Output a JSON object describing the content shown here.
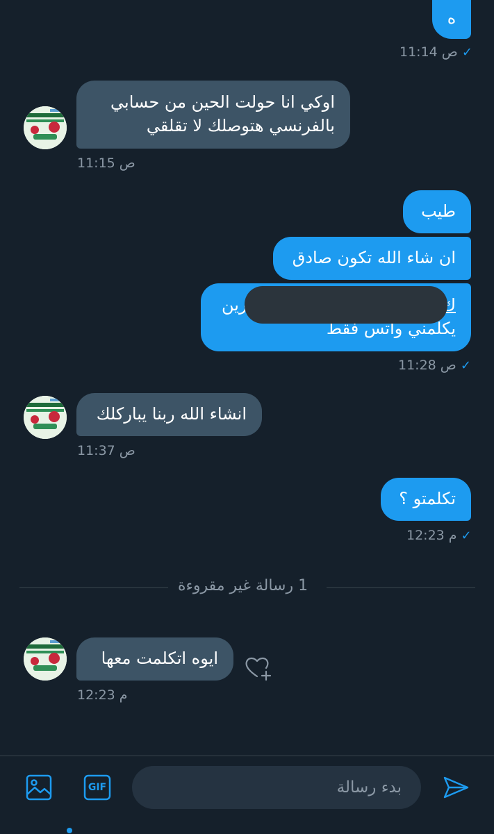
{
  "messages": [
    {
      "text": "ه"
    },
    {
      "time": "11:14 ص"
    },
    {
      "text_line1": "اوكي انا حولت الحين من حسابي",
      "text_line2": "بالفرنسي هتوصلك لا تقلقي"
    },
    {
      "time": "11:15 ص"
    },
    {
      "text": "طيب"
    },
    {
      "text": "ان شاء الله تكون صادق"
    },
    {
      "text_line1_start": "ك",
      "text_line1_end": "برين",
      "text_line2": "يكلمني واتس فقط"
    },
    {
      "time": "11:28 ص"
    },
    {
      "text": "انشاء الله ربنا يباركلك"
    },
    {
      "time": "11:37 ص"
    },
    {
      "text": "تكلمتو ؟"
    },
    {
      "time": "12:23 م"
    },
    {
      "text": "ايوه اتكلمت معها"
    },
    {
      "time": "12:23 م"
    }
  ],
  "divider": {
    "text": "1 رسالة غير مقروءة"
  },
  "composer": {
    "placeholder": "بدء رسالة",
    "gif_label": "GIF"
  },
  "icons": {
    "image": "image-icon",
    "gif": "gif-icon",
    "send": "send-icon",
    "like": "heart-plus-icon",
    "check": "check-icon"
  },
  "colors": {
    "background": "#15202b",
    "outgoing_bubble": "#1d9bf0",
    "incoming_bubble": "#3d5466",
    "accent": "#1d9bf0",
    "timestamp": "#8b98a5"
  }
}
